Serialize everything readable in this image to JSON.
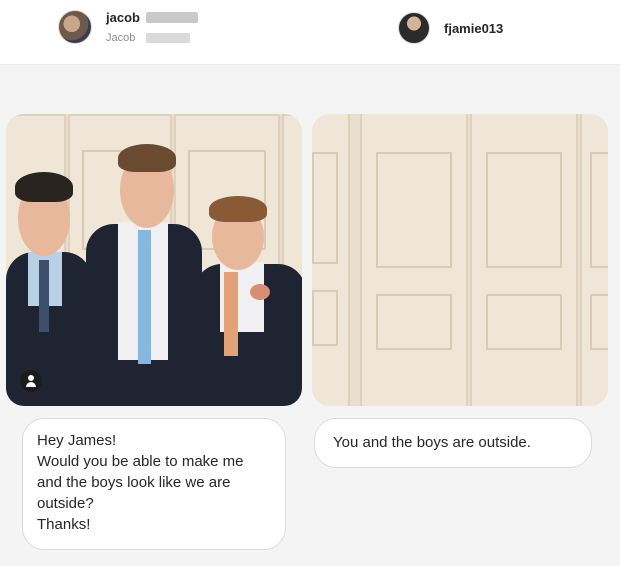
{
  "left_user": {
    "username": "jacob",
    "display_name": "Jacob"
  },
  "right_user": {
    "username": "fjamie013"
  },
  "messages": {
    "request": "Hey James!\nWould you be able to make me\nand the boys look like we are\noutside?\nThanks!",
    "reply": "You and the boys are outside."
  },
  "icons": {
    "left_avatar": "user-avatar",
    "right_avatar": "user-avatar",
    "tag": "person-tag-icon"
  },
  "colors": {
    "background": "#f4f4f4",
    "bubble": "#ffffff",
    "bubble_border": "#dbdbdb",
    "wall": "#efe6d7"
  }
}
